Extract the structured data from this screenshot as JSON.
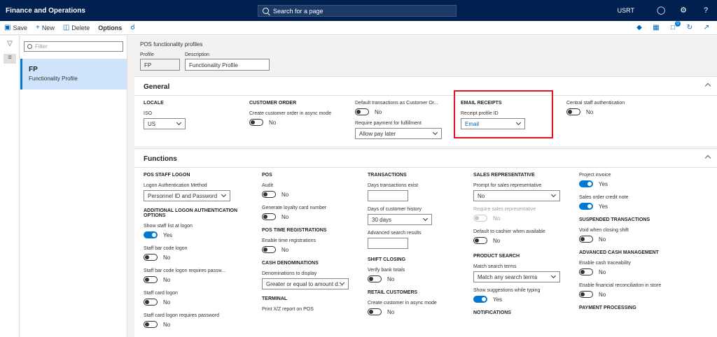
{
  "topbar": {
    "app_title": "Finance and Operations",
    "search_placeholder": "Search for a page",
    "company": "USRT",
    "help": "?"
  },
  "actions": {
    "save": "Save",
    "new": "New",
    "delete": "Delete",
    "options": "Options",
    "notification_count": "0"
  },
  "list": {
    "filter_placeholder": "Filter",
    "item_title": "FP",
    "item_sub": "Functionality Profile"
  },
  "header": {
    "page_title": "POS functionality profiles",
    "profile_label": "Profile",
    "profile_value": "FP",
    "description_label": "Description",
    "description_value": "Functionality Profile"
  },
  "general": {
    "title": "General",
    "locale": {
      "group": "LOCALE",
      "iso_label": "ISO",
      "iso_value": "US"
    },
    "customer_order": {
      "group": "CUSTOMER ORDER",
      "async_label": "Create customer order in async mode",
      "async_value": "No"
    },
    "defaults": {
      "default_trans_label": "Default transactions as Customer Or...",
      "default_trans_value": "No",
      "req_payment_label": "Require payment for fulfillment",
      "req_payment_value": "Allow pay later"
    },
    "email": {
      "group": "EMAIL RECEIPTS",
      "receipt_label": "Receipt profile ID",
      "receipt_value": "Email"
    },
    "central": {
      "label": "Central staff authentication",
      "value": "No"
    }
  },
  "functions": {
    "title": "Functions",
    "col1": {
      "staff_group": "POS STAFF LOGON",
      "logon_method_label": "Logon Authentication Method",
      "logon_method_value": "Personnel ID and Password",
      "addl_group": "ADDITIONAL LOGON AUTHENTICATION OPTIONS",
      "show_staff_label": "Show staff list at logon",
      "show_staff_value": "Yes",
      "barcode_label": "Staff bar code logon",
      "barcode_value": "No",
      "barcode_pw_label": "Staff bar code logon requires passw...",
      "barcode_pw_value": "No",
      "card_label": "Staff card logon",
      "card_value": "No",
      "card_pw_label": "Staff card logon requires password",
      "card_pw_value": "No"
    },
    "col2": {
      "pos_group": "POS",
      "audit_label": "Audit",
      "audit_value": "No",
      "loyalty_label": "Generate loyalty card number",
      "loyalty_value": "No",
      "time_group": "POS TIME REGISTRATIONS",
      "time_label": "Enable time registrations",
      "time_value": "No",
      "denom_group": "CASH DENOMINATIONS",
      "denom_label": "Denominations to display",
      "denom_value": "Greater or equal to amount d...",
      "terminal_group": "TERMINAL",
      "print_label": "Print X/Z report on POS"
    },
    "col3": {
      "trans_group": "TRANSACTIONS",
      "days_exist_label": "Days transactions exist",
      "days_history_label": "Days of customer history",
      "days_history_value": "30 days",
      "adv_search_label": "Advanced search results",
      "shift_group": "SHIFT CLOSING",
      "verify_label": "Verify bank totals",
      "verify_value": "No",
      "retail_group": "RETAIL CUSTOMERS",
      "create_cust_label": "Create customer in async mode",
      "create_cust_value": "No"
    },
    "col4": {
      "sales_group": "SALES REPRESENTATIVE",
      "prompt_label": "Prompt for sales representative",
      "prompt_value": "No",
      "require_label": "Require sales representative",
      "require_value": "No",
      "default_label": "Default to cashier when available",
      "default_value": "No",
      "product_group": "PRODUCT SEARCH",
      "match_label": "Match search terms",
      "match_value": "Match any search terms",
      "suggest_label": "Show suggestions while typing",
      "suggest_value": "Yes",
      "notif_group": "NOTIFICATIONS"
    },
    "col5": {
      "project_label": "Project invoice",
      "project_value": "Yes",
      "credit_label": "Sales order credit note",
      "credit_value": "Yes",
      "suspended_group": "SUSPENDED TRANSACTIONS",
      "void_label": "Void when closing shift",
      "void_value": "No",
      "cash_group": "ADVANCED CASH MANAGEMENT",
      "trace_label": "Enable cash traceability",
      "trace_value": "No",
      "recon_label": "Enable financial reconciliation in store",
      "recon_value": "No",
      "payment_group": "PAYMENT PROCESSING"
    }
  }
}
